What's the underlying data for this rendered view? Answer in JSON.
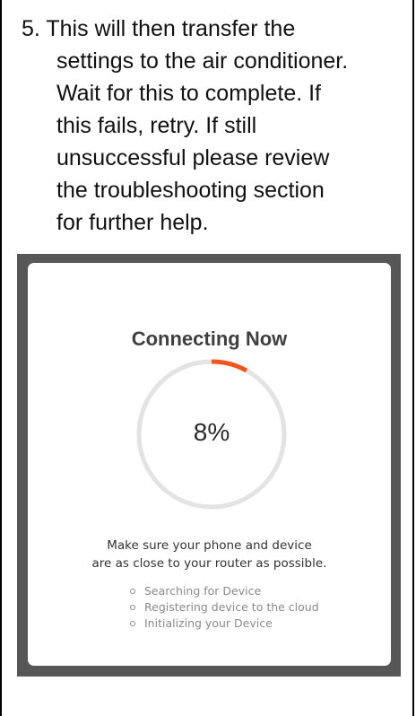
{
  "instruction": {
    "lines": [
      "5. This will then transfer the",
      "settings to the air conditioner.",
      "Wait for this to complete. If",
      "this fails, retry. If still",
      "unsuccessful please review",
      "the troubleshooting section",
      "for further help."
    ]
  },
  "screen": {
    "title": "Connecting Now",
    "progress_percent": 8,
    "progress_label": "8%",
    "hint_lines": [
      "Make sure your phone and device",
      "are as close to your router as possible."
    ],
    "status_items": [
      "Searching for Device",
      "Registering device to the cloud",
      "Initializing your Device"
    ]
  },
  "colors": {
    "progress_accent": "#f2551c",
    "progress_track": "#e3e3e3",
    "frame": "#575757"
  }
}
